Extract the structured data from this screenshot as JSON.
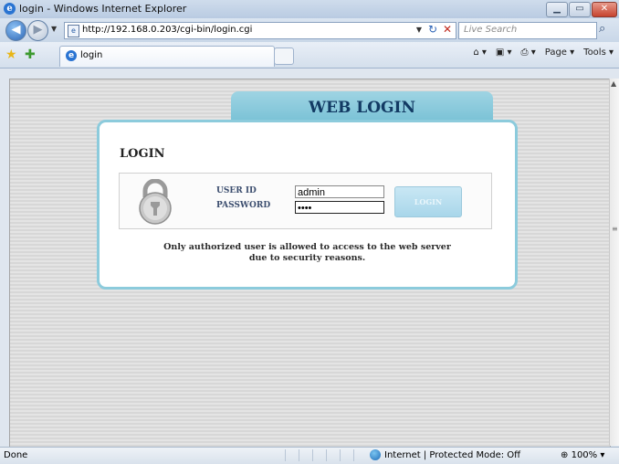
{
  "window": {
    "title": "login - Windows Internet Explorer",
    "buttons": {
      "minimize": "▁",
      "maximize": "▭",
      "close": "✕"
    }
  },
  "address": {
    "url": "http://192.168.0.203/cgi-bin/login.cgi",
    "search_placeholder": "Live Search"
  },
  "tab": {
    "label": "login"
  },
  "toolbar": {
    "page": "Page ▾",
    "tools": "Tools ▾"
  },
  "login": {
    "tab_title": "WEB LOGIN",
    "heading": "LOGIN",
    "userid_label": "USER ID",
    "password_label": "PASSWORD",
    "userid_value": "admin",
    "password_value": "••••",
    "button": "LOGIN",
    "notice_line1": "Only authorized user is allowed to access to the web server",
    "notice_line2": "due to security reasons."
  },
  "status": {
    "left": "Done",
    "zone": "Internet | Protected Mode: Off",
    "zoom": "100%"
  },
  "colors": {
    "accent": "#8ccbdc",
    "tab_header": "#74bfd4",
    "title_text": "#123a63"
  }
}
